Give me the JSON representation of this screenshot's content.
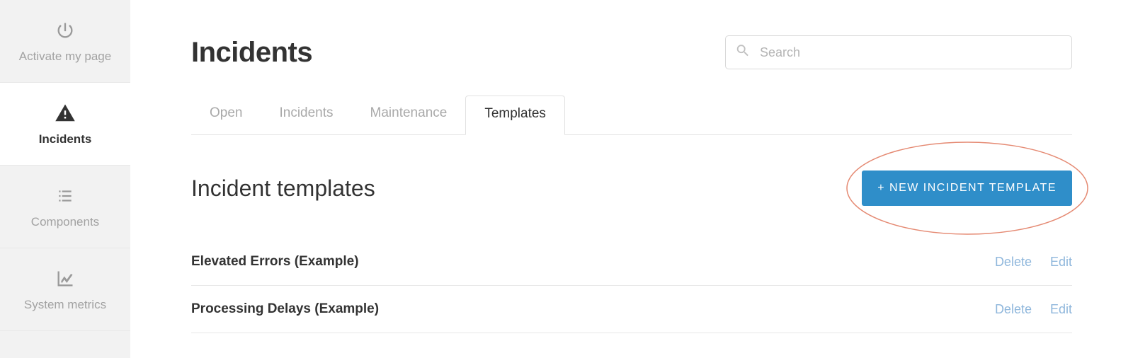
{
  "sidebar": {
    "items": [
      {
        "label": "Activate my page",
        "icon": "power-icon",
        "active": false
      },
      {
        "label": "Incidents",
        "icon": "warning-icon",
        "active": true
      },
      {
        "label": "Components",
        "icon": "list-icon",
        "active": false
      },
      {
        "label": "System metrics",
        "icon": "chart-icon",
        "active": false
      }
    ]
  },
  "header": {
    "title": "Incidents",
    "search_placeholder": "Search"
  },
  "tabs": [
    {
      "label": "Open",
      "active": false
    },
    {
      "label": "Incidents",
      "active": false
    },
    {
      "label": "Maintenance",
      "active": false
    },
    {
      "label": "Templates",
      "active": true
    }
  ],
  "section": {
    "title": "Incident templates",
    "new_button_label": "+ NEW INCIDENT TEMPLATE"
  },
  "templates": [
    {
      "name": "Elevated Errors (Example)",
      "delete_label": "Delete",
      "edit_label": "Edit"
    },
    {
      "name": "Processing Delays (Example)",
      "delete_label": "Delete",
      "edit_label": "Edit"
    }
  ],
  "colors": {
    "accent": "#2f8ec9",
    "highlight": "#e58a73",
    "muted": "#9a9a9a",
    "link": "#8fb7dc"
  }
}
